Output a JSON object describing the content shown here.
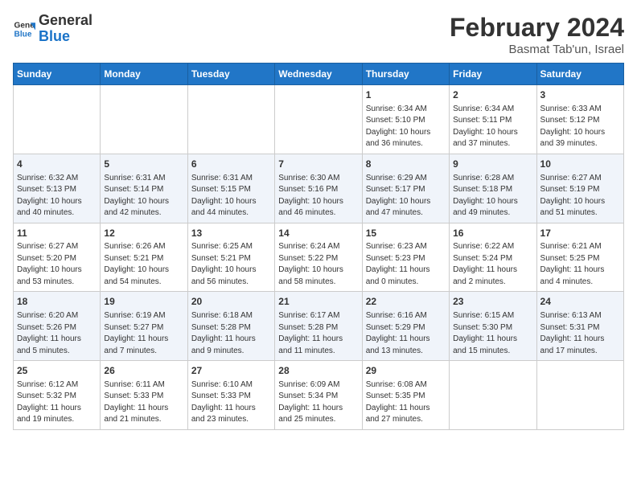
{
  "header": {
    "logo_line1": "General",
    "logo_line2": "Blue",
    "main_title": "February 2024",
    "sub_title": "Basmat Tab'un, Israel"
  },
  "weekdays": [
    "Sunday",
    "Monday",
    "Tuesday",
    "Wednesday",
    "Thursday",
    "Friday",
    "Saturday"
  ],
  "weeks": [
    [
      {
        "day": "",
        "info": ""
      },
      {
        "day": "",
        "info": ""
      },
      {
        "day": "",
        "info": ""
      },
      {
        "day": "",
        "info": ""
      },
      {
        "day": "1",
        "info": "Sunrise: 6:34 AM\nSunset: 5:10 PM\nDaylight: 10 hours\nand 36 minutes."
      },
      {
        "day": "2",
        "info": "Sunrise: 6:34 AM\nSunset: 5:11 PM\nDaylight: 10 hours\nand 37 minutes."
      },
      {
        "day": "3",
        "info": "Sunrise: 6:33 AM\nSunset: 5:12 PM\nDaylight: 10 hours\nand 39 minutes."
      }
    ],
    [
      {
        "day": "4",
        "info": "Sunrise: 6:32 AM\nSunset: 5:13 PM\nDaylight: 10 hours\nand 40 minutes."
      },
      {
        "day": "5",
        "info": "Sunrise: 6:31 AM\nSunset: 5:14 PM\nDaylight: 10 hours\nand 42 minutes."
      },
      {
        "day": "6",
        "info": "Sunrise: 6:31 AM\nSunset: 5:15 PM\nDaylight: 10 hours\nand 44 minutes."
      },
      {
        "day": "7",
        "info": "Sunrise: 6:30 AM\nSunset: 5:16 PM\nDaylight: 10 hours\nand 46 minutes."
      },
      {
        "day": "8",
        "info": "Sunrise: 6:29 AM\nSunset: 5:17 PM\nDaylight: 10 hours\nand 47 minutes."
      },
      {
        "day": "9",
        "info": "Sunrise: 6:28 AM\nSunset: 5:18 PM\nDaylight: 10 hours\nand 49 minutes."
      },
      {
        "day": "10",
        "info": "Sunrise: 6:27 AM\nSunset: 5:19 PM\nDaylight: 10 hours\nand 51 minutes."
      }
    ],
    [
      {
        "day": "11",
        "info": "Sunrise: 6:27 AM\nSunset: 5:20 PM\nDaylight: 10 hours\nand 53 minutes."
      },
      {
        "day": "12",
        "info": "Sunrise: 6:26 AM\nSunset: 5:21 PM\nDaylight: 10 hours\nand 54 minutes."
      },
      {
        "day": "13",
        "info": "Sunrise: 6:25 AM\nSunset: 5:21 PM\nDaylight: 10 hours\nand 56 minutes."
      },
      {
        "day": "14",
        "info": "Sunrise: 6:24 AM\nSunset: 5:22 PM\nDaylight: 10 hours\nand 58 minutes."
      },
      {
        "day": "15",
        "info": "Sunrise: 6:23 AM\nSunset: 5:23 PM\nDaylight: 11 hours\nand 0 minutes."
      },
      {
        "day": "16",
        "info": "Sunrise: 6:22 AM\nSunset: 5:24 PM\nDaylight: 11 hours\nand 2 minutes."
      },
      {
        "day": "17",
        "info": "Sunrise: 6:21 AM\nSunset: 5:25 PM\nDaylight: 11 hours\nand 4 minutes."
      }
    ],
    [
      {
        "day": "18",
        "info": "Sunrise: 6:20 AM\nSunset: 5:26 PM\nDaylight: 11 hours\nand 5 minutes."
      },
      {
        "day": "19",
        "info": "Sunrise: 6:19 AM\nSunset: 5:27 PM\nDaylight: 11 hours\nand 7 minutes."
      },
      {
        "day": "20",
        "info": "Sunrise: 6:18 AM\nSunset: 5:28 PM\nDaylight: 11 hours\nand 9 minutes."
      },
      {
        "day": "21",
        "info": "Sunrise: 6:17 AM\nSunset: 5:28 PM\nDaylight: 11 hours\nand 11 minutes."
      },
      {
        "day": "22",
        "info": "Sunrise: 6:16 AM\nSunset: 5:29 PM\nDaylight: 11 hours\nand 13 minutes."
      },
      {
        "day": "23",
        "info": "Sunrise: 6:15 AM\nSunset: 5:30 PM\nDaylight: 11 hours\nand 15 minutes."
      },
      {
        "day": "24",
        "info": "Sunrise: 6:13 AM\nSunset: 5:31 PM\nDaylight: 11 hours\nand 17 minutes."
      }
    ],
    [
      {
        "day": "25",
        "info": "Sunrise: 6:12 AM\nSunset: 5:32 PM\nDaylight: 11 hours\nand 19 minutes."
      },
      {
        "day": "26",
        "info": "Sunrise: 6:11 AM\nSunset: 5:33 PM\nDaylight: 11 hours\nand 21 minutes."
      },
      {
        "day": "27",
        "info": "Sunrise: 6:10 AM\nSunset: 5:33 PM\nDaylight: 11 hours\nand 23 minutes."
      },
      {
        "day": "28",
        "info": "Sunrise: 6:09 AM\nSunset: 5:34 PM\nDaylight: 11 hours\nand 25 minutes."
      },
      {
        "day": "29",
        "info": "Sunrise: 6:08 AM\nSunset: 5:35 PM\nDaylight: 11 hours\nand 27 minutes."
      },
      {
        "day": "",
        "info": ""
      },
      {
        "day": "",
        "info": ""
      }
    ]
  ]
}
